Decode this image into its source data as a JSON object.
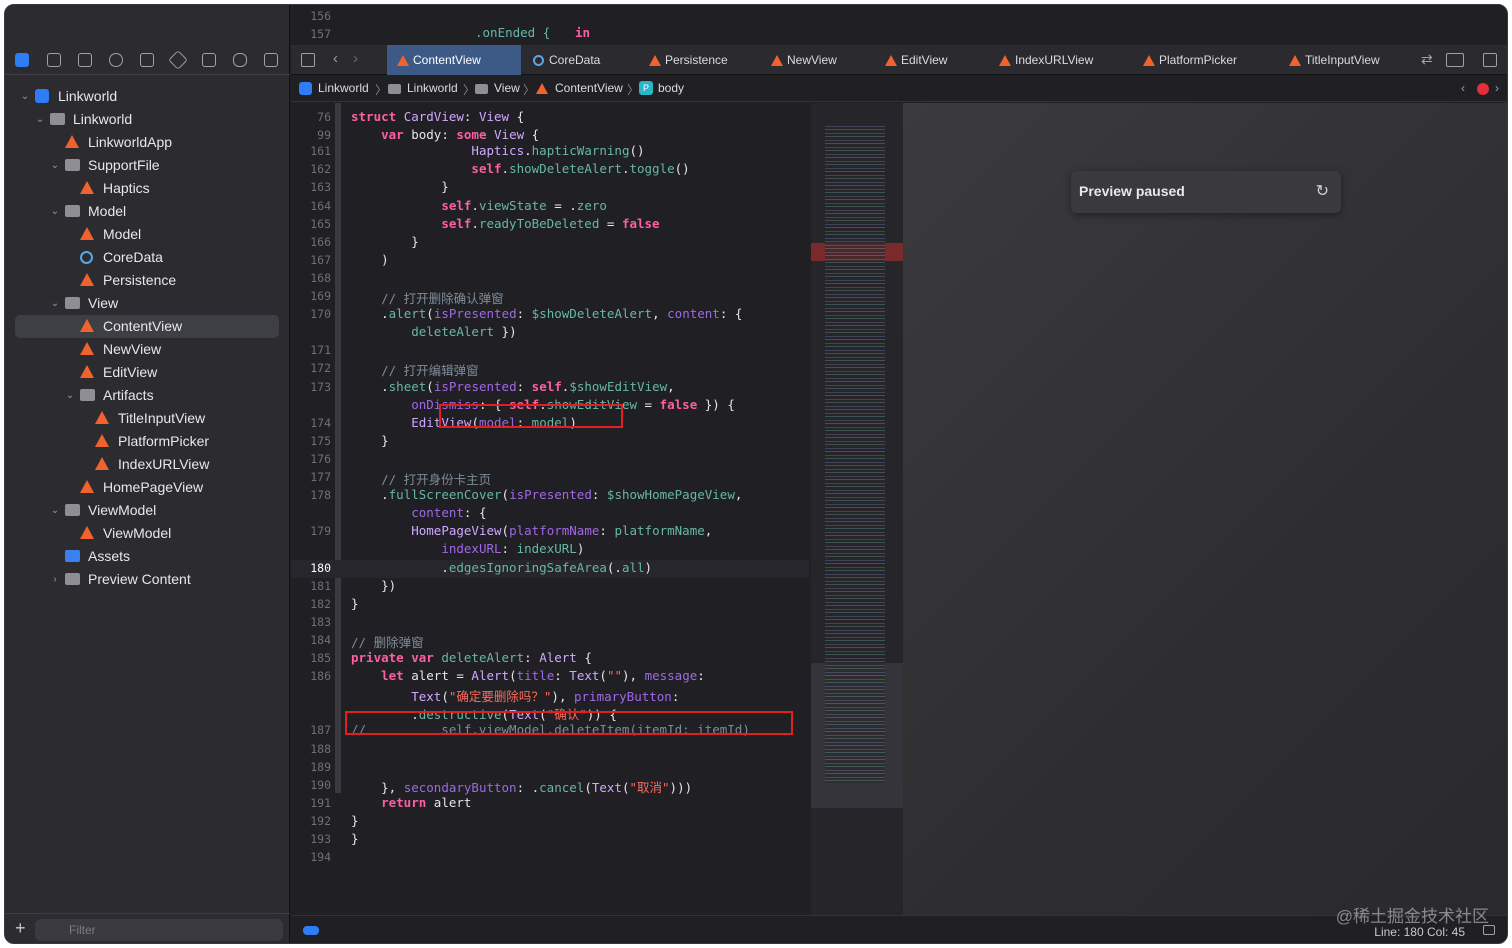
{
  "sidebar": {
    "filter_placeholder": "Filter",
    "add_label": "+",
    "tree": [
      {
        "label": "Linkworld",
        "icon": "app",
        "indent": 0,
        "disc": "⌄"
      },
      {
        "label": "Linkworld",
        "icon": "folder",
        "indent": 1,
        "disc": "⌄"
      },
      {
        "label": "LinkworldApp",
        "icon": "swift",
        "indent": 2,
        "disc": ""
      },
      {
        "label": "SupportFile",
        "icon": "folder",
        "indent": 2,
        "disc": "⌄"
      },
      {
        "label": "Haptics",
        "icon": "swift",
        "indent": 3,
        "disc": ""
      },
      {
        "label": "Model",
        "icon": "folder",
        "indent": 2,
        "disc": "⌄"
      },
      {
        "label": "Model",
        "icon": "swift",
        "indent": 3,
        "disc": ""
      },
      {
        "label": "CoreData",
        "icon": "cd",
        "indent": 3,
        "disc": ""
      },
      {
        "label": "Persistence",
        "icon": "swift",
        "indent": 3,
        "disc": ""
      },
      {
        "label": "View",
        "icon": "folder",
        "indent": 2,
        "disc": "⌄"
      },
      {
        "label": "ContentView",
        "icon": "swift",
        "indent": 3,
        "disc": "",
        "selected": true
      },
      {
        "label": "NewView",
        "icon": "swift",
        "indent": 3,
        "disc": ""
      },
      {
        "label": "EditView",
        "icon": "swift",
        "indent": 3,
        "disc": ""
      },
      {
        "label": "Artifacts",
        "icon": "folder",
        "indent": 3,
        "disc": "⌄"
      },
      {
        "label": "TitleInputView",
        "icon": "swift",
        "indent": 4,
        "disc": ""
      },
      {
        "label": "PlatformPicker",
        "icon": "swift",
        "indent": 4,
        "disc": ""
      },
      {
        "label": "IndexURLView",
        "icon": "swift",
        "indent": 4,
        "disc": ""
      },
      {
        "label": "HomePageView",
        "icon": "swift",
        "indent": 3,
        "disc": ""
      },
      {
        "label": "ViewModel",
        "icon": "folder",
        "indent": 2,
        "disc": "⌄"
      },
      {
        "label": "ViewModel",
        "icon": "swift",
        "indent": 3,
        "disc": ""
      },
      {
        "label": "Assets",
        "icon": "assets",
        "indent": 2,
        "disc": ""
      },
      {
        "label": "Preview Content",
        "icon": "folder",
        "indent": 2,
        "disc": "›"
      }
    ]
  },
  "tabs": [
    {
      "label": "ContentView",
      "active": true
    },
    {
      "label": "CoreData",
      "icon": "cd"
    },
    {
      "label": "Persistence"
    },
    {
      "label": "NewView"
    },
    {
      "label": "EditView"
    },
    {
      "label": "IndexURLView"
    },
    {
      "label": "PlatformPicker"
    },
    {
      "label": "TitleInputView"
    }
  ],
  "jumpbar": {
    "items": [
      "Linkworld",
      "Linkworld",
      "View",
      "ContentView",
      "body"
    ],
    "sep": "〉"
  },
  "top_code": {
    "l156": "156",
    "l157": "157",
    "t157a": ".onEnded {",
    "t157b": "in"
  },
  "code_lines": [
    {
      "n": "76",
      "h": "<span class='kw'>struct</span> <span class='ty'>CardView</span>: <span class='ty'>View</span> {"
    },
    {
      "n": "99",
      "h": "    <span class='kw'>var</span> body: <span class='kw'>some</span> <span class='ty'>View</span> {"
    },
    {
      "n": "161",
      "h": "                <span class='ty'>Haptics</span>.<span class='fn'>hapticWarning</span>()"
    },
    {
      "n": "162",
      "h": "                <span class='kw'>self</span>.<span class='fn'>showDeleteAlert</span>.<span class='fn'>toggle</span>()"
    },
    {
      "n": "163",
      "h": "            }"
    },
    {
      "n": "164",
      "h": "            <span class='kw'>self</span>.<span class='fn'>viewState</span> = .<span class='fn'>zero</span>"
    },
    {
      "n": "165",
      "h": "            <span class='kw'>self</span>.<span class='fn'>readyToBeDeleted</span> = <span class='kw'>false</span>"
    },
    {
      "n": "166",
      "h": "        }"
    },
    {
      "n": "167",
      "h": "    )"
    },
    {
      "n": "168",
      "h": ""
    },
    {
      "n": "169",
      "h": "    <span class='cm'>// 打开删除确认弹窗</span>"
    },
    {
      "n": "170",
      "h": "    .<span class='fn'>alert</span>(<span class='pm'>isPresented</span>: <span class='fn'>$showDeleteAlert</span>, <span class='pm'>content</span>: {"
    },
    {
      "n": "",
      "h": "        <span class='fn'>deleteAlert</span> })"
    },
    {
      "n": "171",
      "h": ""
    },
    {
      "n": "172",
      "h": "    <span class='cm'>// 打开编辑弹窗</span>"
    },
    {
      "n": "173",
      "h": "    .<span class='fn'>sheet</span>(<span class='pm'>isPresented</span>: <span class='kw'>self</span>.<span class='fn'>$showEditView</span>,"
    },
    {
      "n": "",
      "h": "        <span class='pm'>onDismiss</span>: { <span class='kw'>self</span>.<span class='fn'>showEditView</span> = <span class='kw'>false</span> }) {"
    },
    {
      "n": "174",
      "h": "        <span class='ty'>EditView</span>(<span class='pm'>model</span>: <span class='fn'>model</span>)"
    },
    {
      "n": "175",
      "h": "    }"
    },
    {
      "n": "176",
      "h": ""
    },
    {
      "n": "177",
      "h": "    <span class='cm'>// 打开身份卡主页</span>"
    },
    {
      "n": "178",
      "h": "    .<span class='fn'>fullScreenCover</span>(<span class='pm'>isPresented</span>: <span class='fn'>$showHomePageView</span>,"
    },
    {
      "n": "",
      "h": "        <span class='pm'>content</span>: {"
    },
    {
      "n": "179",
      "h": "        <span class='ty'>HomePageView</span>(<span class='pm'>platformName</span>: <span class='fn'>platformName</span>,"
    },
    {
      "n": "",
      "h": "            <span class='pm'>indexURL</span>: <span class='fn'>indexURL</span>)"
    },
    {
      "n": "180",
      "h": "            .<span class='fn'>edgesIgnoringSafeArea</span>(.<span class='fn'>all</span>)",
      "cur": true
    },
    {
      "n": "181",
      "h": "    })"
    },
    {
      "n": "182",
      "h": "}"
    },
    {
      "n": "183",
      "h": ""
    },
    {
      "n": "184",
      "h": "<span class='cm'>// 删除弹窗</span>"
    },
    {
      "n": "185",
      "h": "<span class='kw'>private</span> <span class='kw'>var</span> <span class='fn'>deleteAlert</span>: <span class='ty'>Alert</span> {"
    },
    {
      "n": "186",
      "h": "    <span class='kw'>let</span> alert = <span class='ty'>Alert</span>(<span class='pm'>title</span>: <span class='ty'>Text</span>(<span class='st'>\"\"</span>), <span class='pm'>message</span>:"
    },
    {
      "n": "",
      "h": "        <span class='ty'>Text</span>(<span class='st'>\"确定要删除吗？\"</span>), <span class='pm'>primaryButton</span>:"
    },
    {
      "n": "",
      "h": "        .<span class='fn'>destructive</span>(<span class='ty'>Text</span>(<span class='st'>\"确认\"</span>)) {"
    },
    {
      "n": "187",
      "h": "<span class='cm'>//          self.viewModel.deleteItem(itemId: itemId)</span>"
    },
    {
      "n": "188",
      "h": ""
    },
    {
      "n": "189",
      "h": ""
    },
    {
      "n": "190",
      "h": "    }, <span class='pm'>secondaryButton</span>: .<span class='fn'>cancel</span>(<span class='ty'>Text</span>(<span class='st'>\"取消\"</span>)))"
    },
    {
      "n": "191",
      "h": "    <span class='kw'>return</span> alert"
    },
    {
      "n": "192",
      "h": "}"
    },
    {
      "n": "193",
      "h": "}"
    },
    {
      "n": "194",
      "h": ""
    }
  ],
  "preview": {
    "status": "Preview paused"
  },
  "status": {
    "line_col": "Line: 180  Col: 45",
    "watermark": "@稀土掘金技术社区"
  },
  "colors": {
    "accent": "#2e7cf6",
    "swift": "#f0622e",
    "highlight_box": "#e02020"
  }
}
